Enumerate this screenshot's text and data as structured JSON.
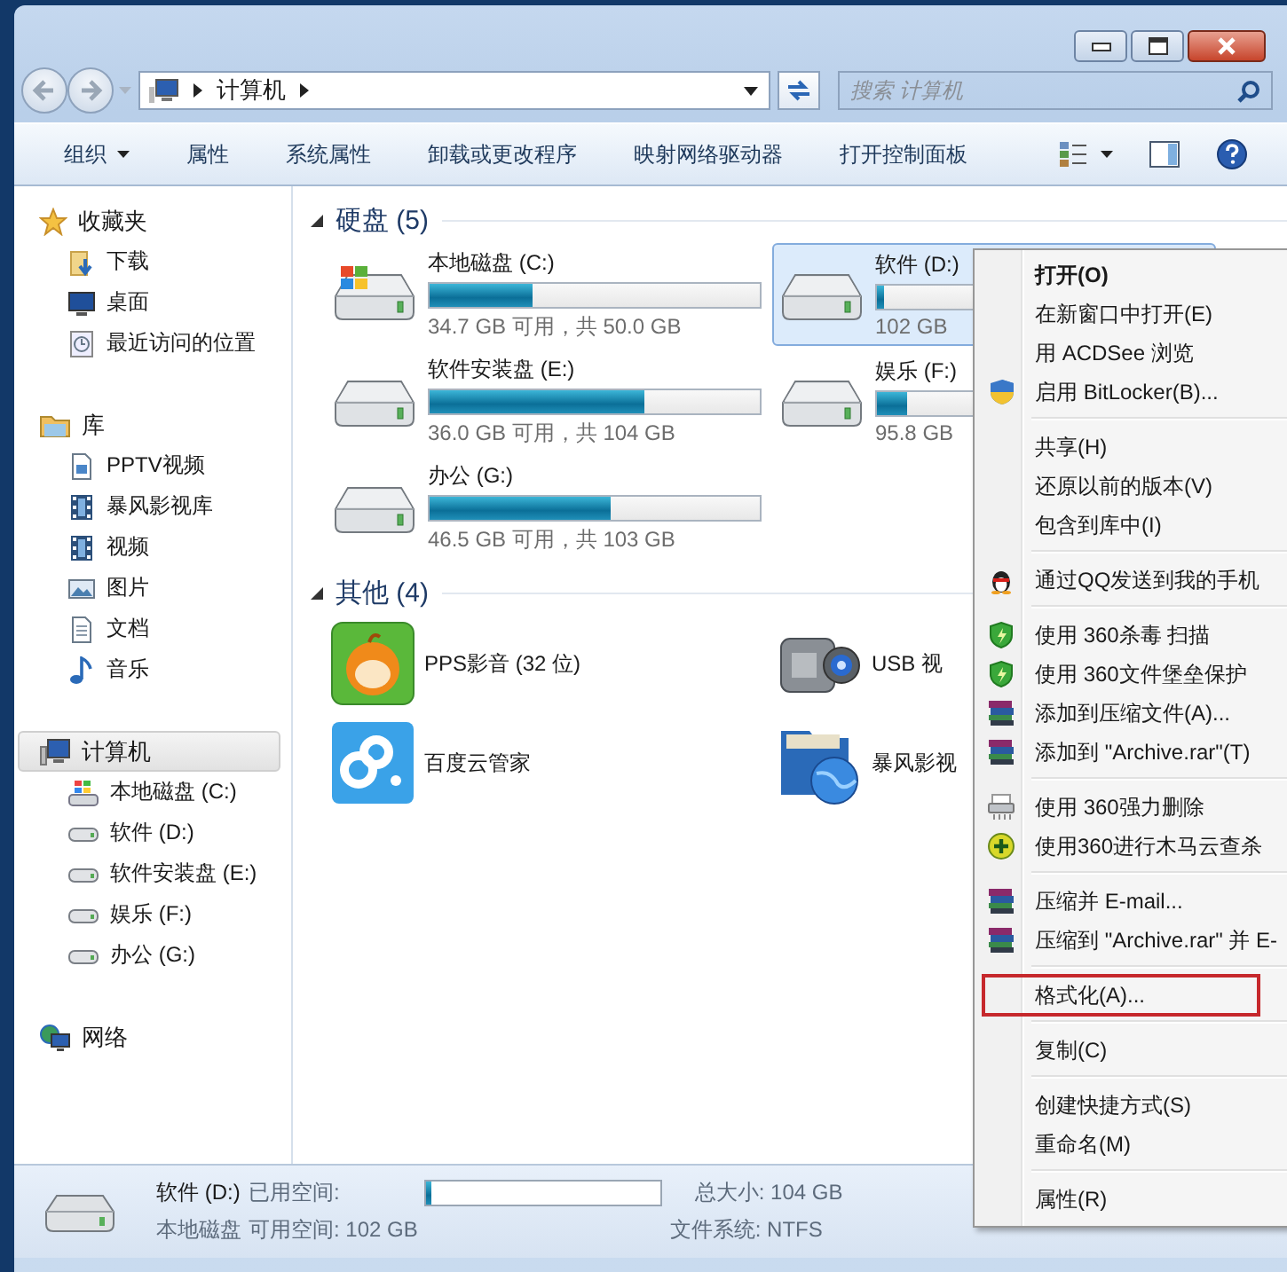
{
  "address": {
    "path": "计算机",
    "placeholder": "搜索 计算机"
  },
  "toolbar": {
    "items": [
      {
        "label": "组织",
        "kind": "menu"
      },
      {
        "label": "属性",
        "kind": "plain"
      },
      {
        "label": "系统属性",
        "kind": "plain"
      },
      {
        "label": "卸载或更改程序",
        "kind": "plain"
      },
      {
        "label": "映射网络驱动器",
        "kind": "plain"
      },
      {
        "label": "打开控制面板",
        "kind": "plain"
      }
    ]
  },
  "sidebar": {
    "groups": [
      {
        "label": "收藏夹",
        "kind": "star",
        "selected": false,
        "children": [
          {
            "label": "下载",
            "kind": "downloads",
            "selected": false
          },
          {
            "label": "桌面",
            "kind": "desktop",
            "selected": false
          },
          {
            "label": "最近访问的位置",
            "kind": "recent",
            "selected": false
          }
        ]
      },
      {
        "label": "库",
        "kind": "library",
        "selected": false,
        "children": [
          {
            "label": "PPTV视频",
            "kind": "page",
            "selected": false
          },
          {
            "label": "暴风影视库",
            "kind": "film",
            "selected": false
          },
          {
            "label": "视频",
            "kind": "film",
            "selected": false
          },
          {
            "label": "图片",
            "kind": "pictures",
            "selected": false
          },
          {
            "label": "文档",
            "kind": "documents",
            "selected": false
          },
          {
            "label": "音乐",
            "kind": "music",
            "selected": false
          }
        ]
      },
      {
        "label": "计算机",
        "kind": "computer",
        "selected": true,
        "children": [
          {
            "label": "本地磁盘 (C:)",
            "kind": "sysdrive",
            "selected": false
          },
          {
            "label": "软件 (D:)",
            "kind": "drive",
            "selected": false
          },
          {
            "label": "软件安装盘 (E:)",
            "kind": "drive",
            "selected": false
          },
          {
            "label": "娱乐 (F:)",
            "kind": "drive",
            "selected": false
          },
          {
            "label": "办公 (G:)",
            "kind": "drive",
            "selected": false
          }
        ]
      },
      {
        "label": "网络",
        "kind": "network",
        "selected": false
      }
    ]
  },
  "content": {
    "groups": [
      {
        "title": "硬盘 (5)",
        "expanded": true,
        "items": [
          {
            "name": "本地磁盘 (C:)",
            "kind": "sysdrive",
            "level": 0.31,
            "free": "34.7 GB 可用，共 50.0 GB",
            "selected": false
          },
          {
            "name": "软件 (D:)",
            "kind": "drive",
            "level": 0.02,
            "free": "102 GB",
            "selected": true
          },
          {
            "name": "软件安装盘 (E:)",
            "kind": "drive",
            "level": 0.65,
            "free": "36.0 GB 可用，共 104 GB",
            "selected": false
          },
          {
            "name": "娱乐 (F:)",
            "kind": "drive",
            "level": 0.09,
            "free": "95.8 GB",
            "selected": false
          },
          {
            "name": "办公 (G:)",
            "kind": "drive",
            "level": 0.55,
            "free": "46.5 GB 可用，共 103 GB",
            "selected": false
          }
        ]
      },
      {
        "title": "其他 (4)",
        "expanded": true,
        "items": [
          {
            "name": "PPS影音 (32 位)",
            "kind": "pps",
            "selected": false
          },
          {
            "name": "USB 视",
            "kind": "camera",
            "selected": false
          },
          {
            "name": "百度云管家",
            "kind": "cloud",
            "selected": false
          },
          {
            "name": "暴风影视",
            "kind": "globe",
            "selected": false
          }
        ]
      }
    ]
  },
  "context_menu": {
    "sections": [
      [
        {
          "label": "打开(O)",
          "kind": "plain",
          "default": true,
          "outlined": false
        },
        {
          "label": "在新窗口中打开(E)",
          "kind": "plain",
          "default": false,
          "outlined": false
        },
        {
          "label": "用 ACDSee 浏览",
          "kind": "plain",
          "default": false,
          "outlined": false
        },
        {
          "label": "启用 BitLocker(B)...",
          "kind": "shield",
          "default": false,
          "outlined": false
        }
      ],
      [
        {
          "label": "共享(H)",
          "kind": "plain",
          "default": false,
          "outlined": false
        },
        {
          "label": "还原以前的版本(V)",
          "kind": "plain",
          "default": false,
          "outlined": false
        },
        {
          "label": "包含到库中(I)",
          "kind": "plain",
          "default": false,
          "outlined": false
        }
      ],
      [
        {
          "label": "通过QQ发送到我的手机",
          "kind": "penguin",
          "default": false,
          "outlined": false
        }
      ],
      [
        {
          "label": "使用 360杀毒 扫描",
          "kind": "guard",
          "default": false,
          "outlined": false
        },
        {
          "label": "使用 360文件堡垒保护",
          "kind": "guard",
          "default": false,
          "outlined": false
        },
        {
          "label": "添加到压缩文件(A)...",
          "kind": "archive",
          "default": false,
          "outlined": false
        },
        {
          "label": "添加到 \"Archive.rar\"(T)",
          "kind": "archive",
          "default": false,
          "outlined": false
        }
      ],
      [
        {
          "label": "使用 360强力删除",
          "kind": "shredder",
          "default": false,
          "outlined": false
        },
        {
          "label": "使用360进行木马云查杀",
          "kind": "plus",
          "default": false,
          "outlined": false
        }
      ],
      [
        {
          "label": "压缩并 E-mail...",
          "kind": "archive",
          "default": false,
          "outlined": false
        },
        {
          "label": "压缩到 \"Archive.rar\" 并 E-",
          "kind": "archive",
          "default": false,
          "outlined": false
        }
      ],
      [
        {
          "label": "格式化(A)...",
          "kind": "plain",
          "default": false,
          "outlined": true
        }
      ],
      [
        {
          "label": "复制(C)",
          "kind": "plain",
          "default": false,
          "outlined": false
        }
      ],
      [
        {
          "label": "创建快捷方式(S)",
          "kind": "plain",
          "default": false,
          "outlined": false
        },
        {
          "label": "重命名(M)",
          "kind": "plain",
          "default": false,
          "outlined": false
        }
      ],
      [
        {
          "label": "属性(R)",
          "kind": "plain",
          "default": false,
          "outlined": false
        }
      ]
    ]
  },
  "status_bar": {
    "name": "软件 (D:)",
    "type": "本地磁盘",
    "used": {
      "label": "已用空间:",
      "level": 0.02
    },
    "free": "可用空间: 102 GB",
    "total": "总大小: 104 GB",
    "filesystem": "文件系统: NTFS"
  }
}
